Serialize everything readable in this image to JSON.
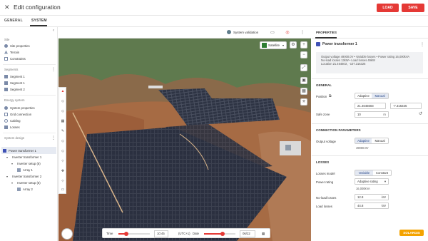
{
  "header": {
    "close_icon": "close-icon",
    "title": "Edit configuration",
    "load_label": "LOAD",
    "save_label": "SAVE",
    "accent": "#e53935"
  },
  "tabs": [
    {
      "label": "GENERAL"
    },
    {
      "label": "SYSTEM"
    }
  ],
  "sidebar": {
    "site": {
      "title": "Site",
      "items": [
        {
          "label": "Site properties"
        },
        {
          "label": "Terrain"
        },
        {
          "label": "Constraints"
        }
      ]
    },
    "segments": {
      "title": "Segments",
      "items": [
        {
          "label": "Segment 1"
        },
        {
          "label": "Segment 1"
        },
        {
          "label": "Segment 2"
        }
      ]
    },
    "energy": {
      "title": "Energy system",
      "items": [
        {
          "label": "System properties"
        },
        {
          "label": "Grid connection"
        },
        {
          "label": "Cabling"
        },
        {
          "label": "Losses"
        }
      ]
    },
    "design": {
      "title": "System design",
      "items": [
        {
          "label": "Power transformer 1"
        },
        {
          "label": "Inverter transformer 1"
        },
        {
          "label": "Inverter setup (6)"
        },
        {
          "label": "Array 1"
        },
        {
          "label": "Inverter transformer 2"
        },
        {
          "label": "Inverter setup (5)"
        },
        {
          "label": "Array 2"
        }
      ]
    }
  },
  "map": {
    "toolbar": {
      "validation_label": "System validation"
    },
    "layer": "Satellite",
    "timebar": {
      "time_label": "Time",
      "time_value": "10:45",
      "tz": "(UTC+1)",
      "date_label": "Date",
      "date_value": "06/22",
      "time_fraction": 0.25,
      "date_fraction": 0.6
    }
  },
  "properties": {
    "tab_label": "PROPERTIES",
    "title": "Power transformer 1",
    "summary": [
      "Output voltage 49000.0V • Variable losses • Power rating 16,000kVA",
      "No-load losses 13kW • Load losses 49kW",
      "Location 21.464603 , -107.316325"
    ],
    "general": {
      "title": "GENERAL",
      "position_label": "Position",
      "position_modes": [
        "Adaptive",
        "Manual"
      ],
      "lat": "21.4645603",
      "lon": "-7.316325",
      "safe_zone_label": "Safe zone",
      "safe_zone_value": "10",
      "safe_zone_unit": "m"
    },
    "connection": {
      "title": "CONNECTION PARAMETERS",
      "output_voltage_label": "Output voltage",
      "modes": [
        "Adaptive",
        "Manual"
      ],
      "output_voltage_value": "49000.0V"
    },
    "losses": {
      "title": "LOSSES",
      "model_label": "Losses model",
      "model_modes": [
        "Variable",
        "Constant"
      ],
      "rating_label": "Power rating",
      "rating_value": "Adaptive rating",
      "rating_sub": "16,000kVA",
      "noload_label": "No-load losses",
      "noload_value": "12.8",
      "noload_unit": "kW",
      "load_label": "Load losses",
      "load_value": "44.8",
      "load_unit": "kW"
    }
  },
  "brand": "SOLARGIS"
}
